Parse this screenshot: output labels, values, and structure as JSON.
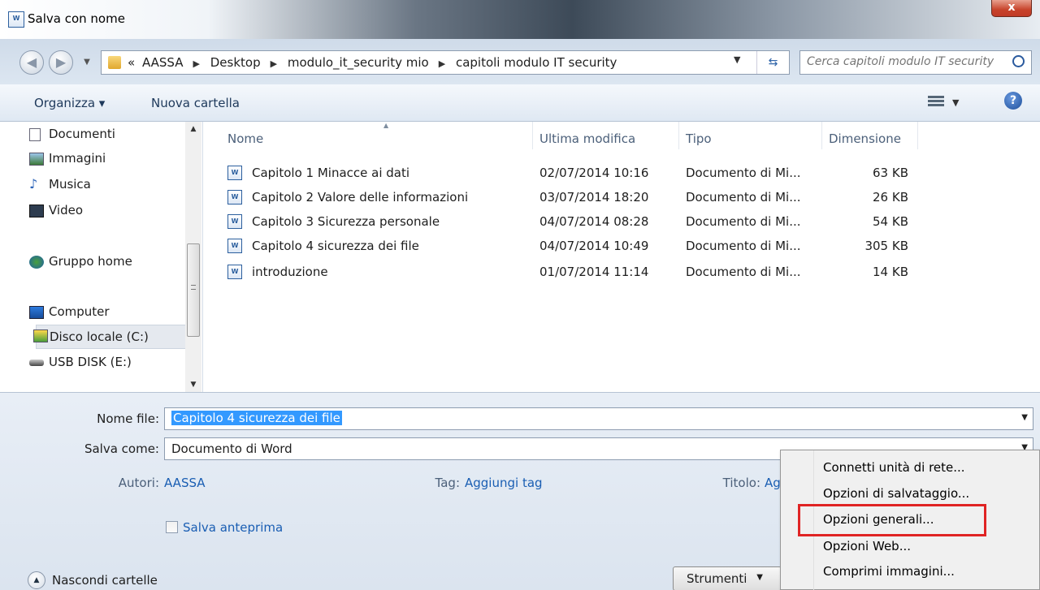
{
  "window": {
    "title": "Salva con nome",
    "close_label": "x"
  },
  "address": {
    "prefix": "«",
    "crumbs": [
      "AASSA",
      "Desktop",
      "modulo_it_security mio",
      "capitoli modulo IT security"
    ],
    "search_placeholder": "Cerca capitoli modulo IT security"
  },
  "toolbar": {
    "organize_label": "Organizza ▾",
    "new_folder_label": "Nuova cartella",
    "help_label": "?"
  },
  "nav": {
    "items": [
      {
        "label": "Documenti",
        "icon": "document-icon"
      },
      {
        "label": "Immagini",
        "icon": "pictures-icon"
      },
      {
        "label": "Musica",
        "icon": "music-icon"
      },
      {
        "label": "Video",
        "icon": "video-icon"
      },
      {
        "label": "Gruppo home",
        "icon": "homegroup-icon"
      },
      {
        "label": "Computer",
        "icon": "computer-icon"
      },
      {
        "label": "Disco locale (C:)",
        "icon": "drive-icon"
      },
      {
        "label": "USB DISK (E:)",
        "icon": "usb-drive-icon"
      }
    ],
    "selected_index": 6
  },
  "files": {
    "columns": [
      "Nome",
      "Ultima modifica",
      "Tipo",
      "Dimensione"
    ],
    "rows": [
      {
        "name": "Capitolo 1 Minacce ai dati",
        "modified": "02/07/2014 10:16",
        "type": "Documento di Mi...",
        "size": "63 KB"
      },
      {
        "name": "Capitolo 2 Valore delle informazioni",
        "modified": "03/07/2014 18:20",
        "type": "Documento di Mi...",
        "size": "26 KB"
      },
      {
        "name": "Capitolo 3 Sicurezza personale",
        "modified": "04/07/2014 08:28",
        "type": "Documento di Mi...",
        "size": "54 KB"
      },
      {
        "name": "Capitolo 4 sicurezza dei file",
        "modified": "04/07/2014 10:49",
        "type": "Documento di Mi...",
        "size": "305 KB"
      },
      {
        "name": "introduzione",
        "modified": "01/07/2014 11:14",
        "type": "Documento di Mi...",
        "size": "14 KB"
      }
    ]
  },
  "form": {
    "filename_label": "Nome file:",
    "filename_value": "Capitolo 4 sicurezza dei file",
    "savetype_label": "Salva come:",
    "savetype_value": "Documento di Word",
    "authors_label": "Autori:",
    "authors_value": "AASSA",
    "tags_label": "Tag:",
    "tags_value": "Aggiungi tag",
    "title_label": "Titolo:",
    "title_value": "Ag",
    "thumbnail_label": "Salva anteprima",
    "hide_folders_label": "Nascondi cartelle",
    "tools_label": "Strumenti"
  },
  "menu": {
    "items": [
      "Connetti unità di rete...",
      "Opzioni di salvataggio...",
      "Opzioni generali...",
      "Opzioni Web...",
      "Comprimi immagini..."
    ],
    "highlighted_index": 2,
    "highlight_color": "#e02424"
  }
}
